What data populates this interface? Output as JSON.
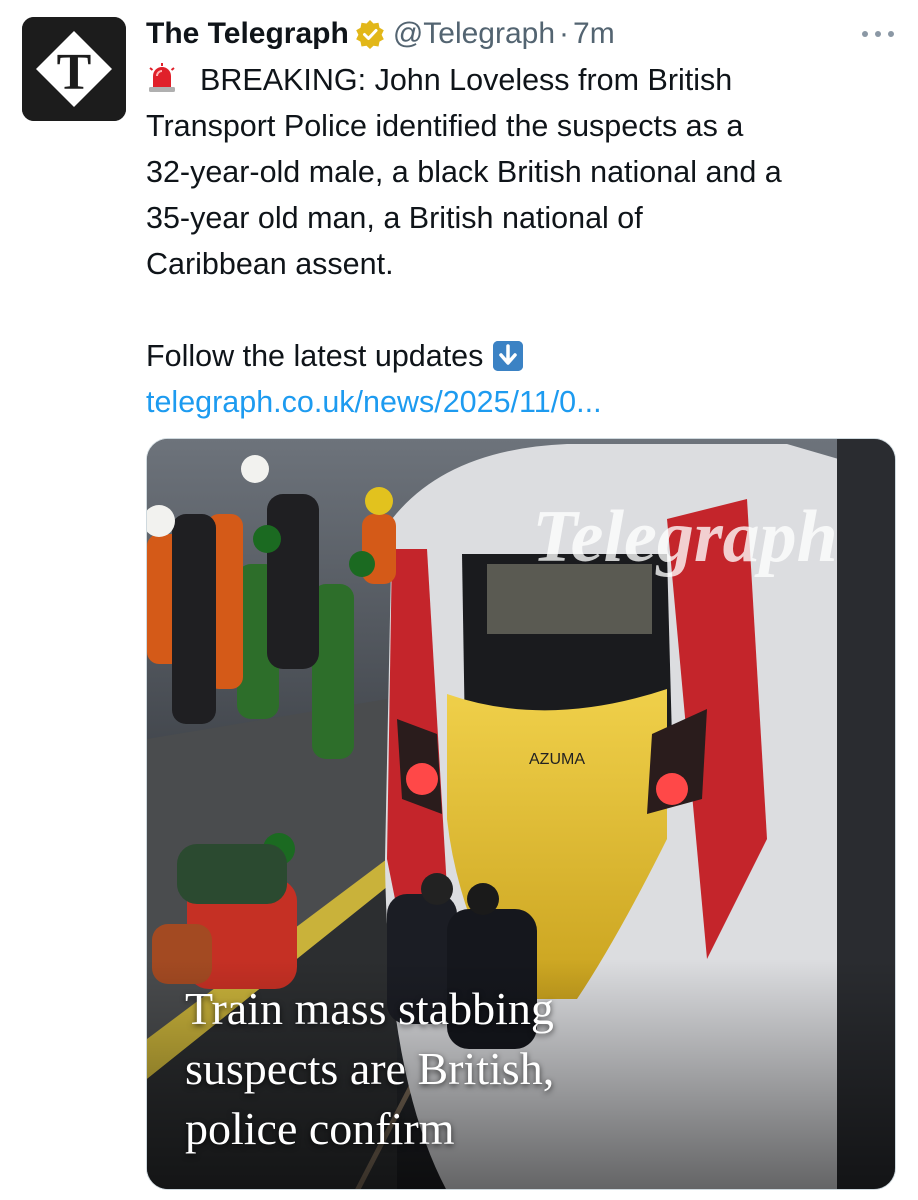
{
  "account": {
    "name": "The Telegraph",
    "handle": "@Telegraph",
    "separator": "·",
    "time": "7m",
    "avatar_icon": "telegraph-t-logo",
    "verified_icon": "gold-verified-badge"
  },
  "tweet": {
    "lines": [
      "BREAKING: John Loveless from British",
      "Transport Police identified the suspects as a",
      "32-year-old male, a black British national and a",
      "35-year old man, a British national of",
      "Caribbean assent."
    ],
    "follow_text": "Follow the latest updates",
    "link": "telegraph.co.uk/news/2025/11/0...",
    "siren_icon": "police-siren-emoji",
    "arrow_icon": "down-arrow-emoji"
  },
  "media": {
    "watermark": "Telegraph",
    "train_label": "AZUMA",
    "headline_lines": [
      "Train mass stabbing",
      "suspects are British,",
      "police confirm"
    ]
  },
  "colors": {
    "link": "#1d9bf0",
    "secondary_text": "#536471",
    "verified": "#e2b719"
  }
}
